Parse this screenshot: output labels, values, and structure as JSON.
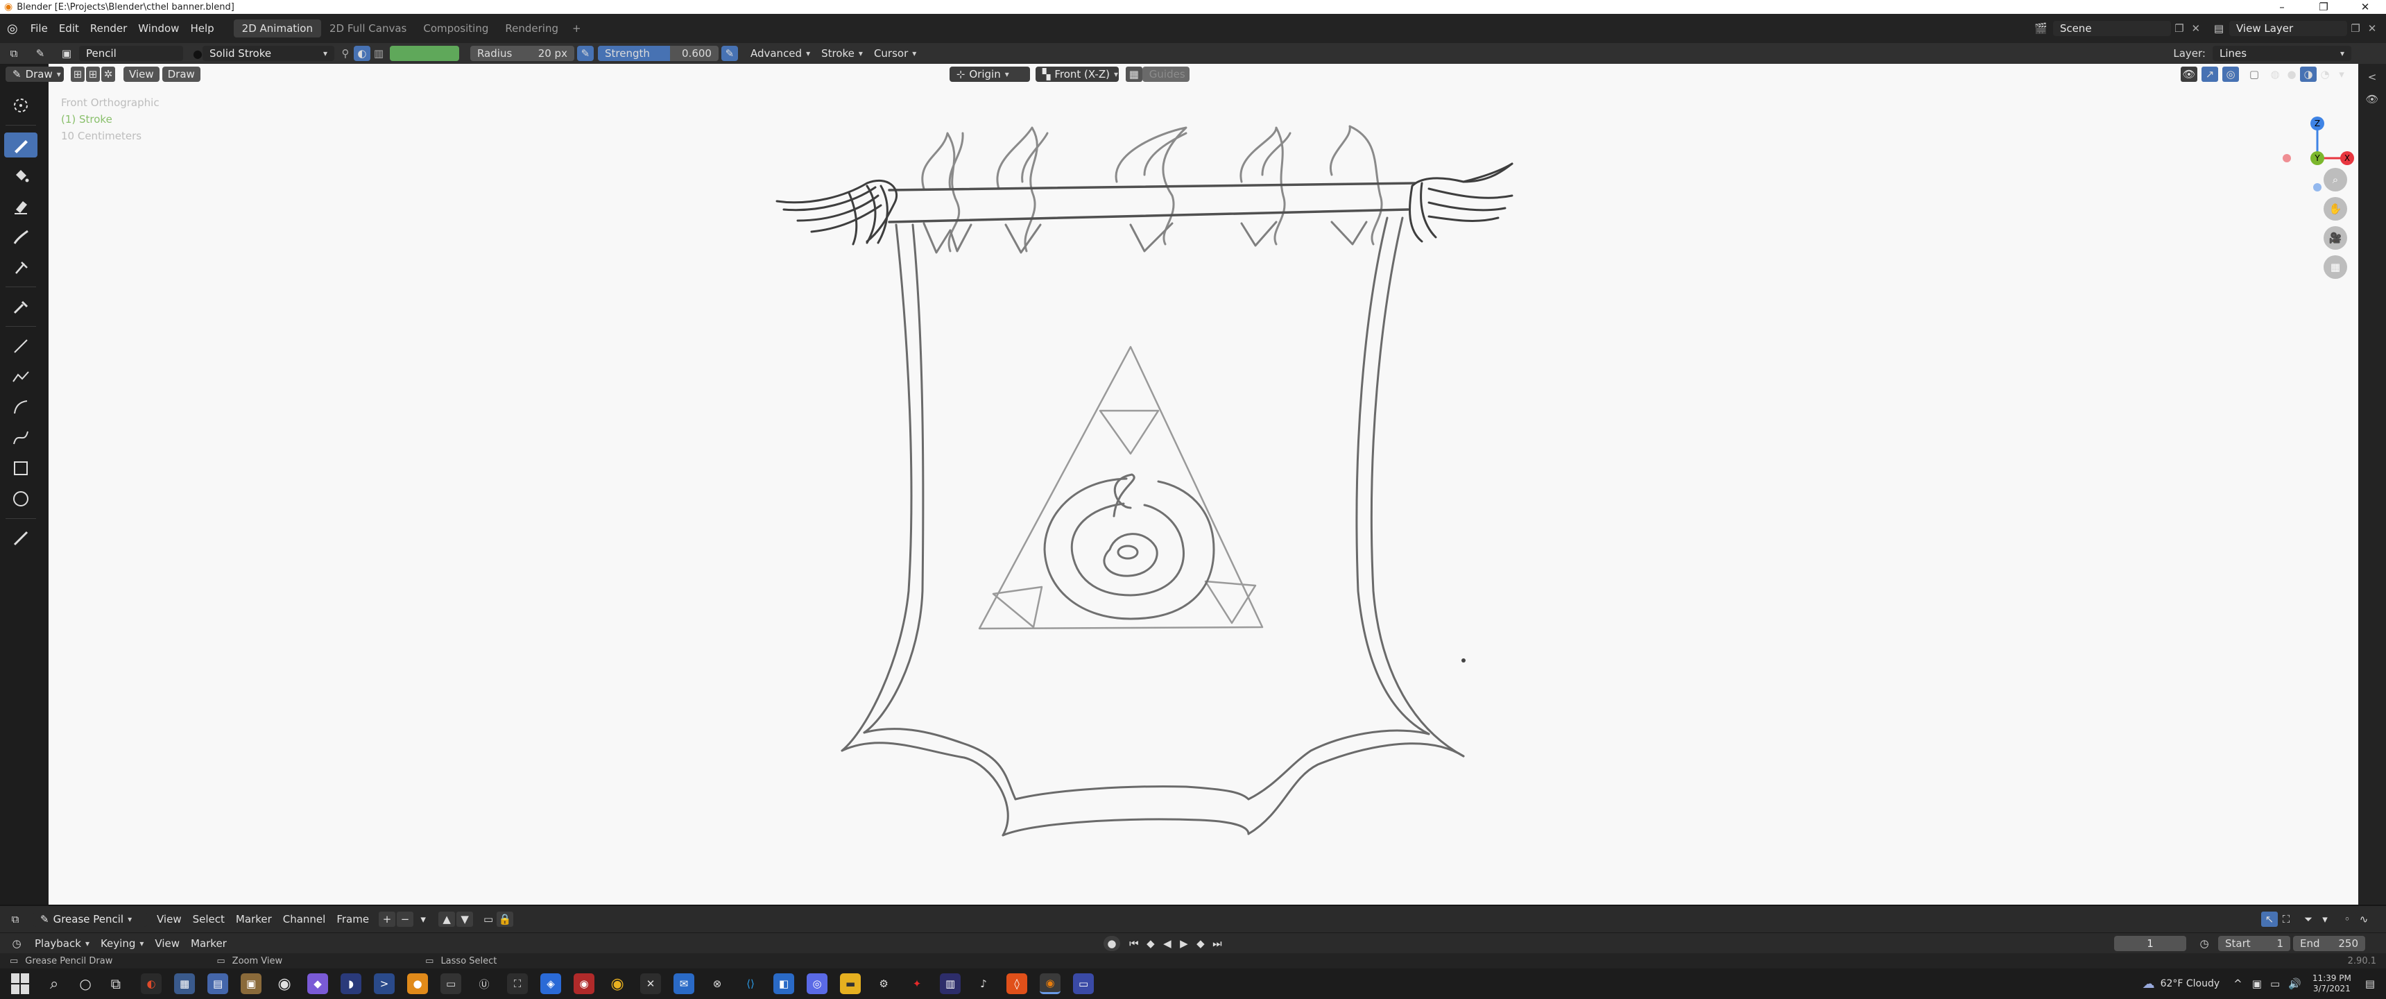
{
  "window": {
    "title": "Blender [E:\\Projects\\Blender\\cthel banner.blend]",
    "controls": [
      "–",
      "❐",
      "✕"
    ]
  },
  "menubar": {
    "menus": [
      "File",
      "Edit",
      "Render",
      "Window",
      "Help"
    ],
    "workspaces": [
      "2D Animation",
      "2D Full Canvas",
      "Compositing",
      "Rendering"
    ],
    "add_workspace": "+",
    "scene_label": "Scene",
    "view_layer_label": "View Layer"
  },
  "tool_header": {
    "brush_name": "Pencil",
    "stroke_type": "Solid Stroke",
    "radius_label": "Radius",
    "radius_value": "20 px",
    "strength_label": "Strength",
    "strength_value": "0.600",
    "strength_fraction": 0.6,
    "advanced_label": "Advanced",
    "stroke_label": "Stroke",
    "cursor_label": "Cursor",
    "layer_label": "Layer:",
    "layer_value": "Lines",
    "material_color": "#5fa85a"
  },
  "viewport_header": {
    "mode": "Draw",
    "view_menu": "View",
    "draw_menu": "Draw",
    "origin": "Origin",
    "view_axis": "Front (X-Z)",
    "guides_label": "Guides"
  },
  "viewport_overlay": {
    "view_name": "Front Orthographic",
    "object_info": "(1) Stroke",
    "scale_info": "10 Centimeters"
  },
  "gizmo": {
    "z": "Z",
    "y": "Y",
    "x": "X"
  },
  "timeline_header": {
    "editor": "Grease Pencil",
    "menus": [
      "View",
      "Select",
      "Marker",
      "Channel",
      "Frame"
    ]
  },
  "playback_bar": {
    "menus": [
      "Playback",
      "Keying",
      "View",
      "Marker"
    ],
    "current_frame": "1",
    "start_label": "Start",
    "start_value": "1",
    "end_label": "End",
    "end_value": "250"
  },
  "statusbar": {
    "hints": [
      "Grease Pencil Draw",
      "Zoom View",
      "Lasso Select"
    ],
    "version": "2.90.1"
  },
  "taskbar": {
    "weather": "62°F  Cloudy",
    "time": "11:39 PM",
    "date": "3/7/2021"
  },
  "colors": {
    "accent": "#4772b3",
    "active_workspace": "#3d3d3d",
    "canvas": "#f8f8f8",
    "object_info": "#8ac06c",
    "axis_x": "#e8363f",
    "axis_y": "#7cb72d",
    "axis_z": "#3f84e5"
  }
}
